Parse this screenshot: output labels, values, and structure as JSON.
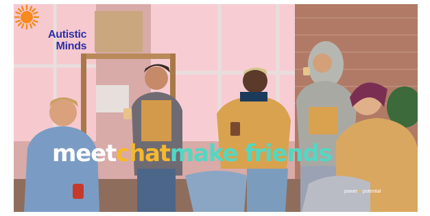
{
  "logo": {
    "line1": "Autistic",
    "line2": "Minds",
    "text_color": "#2d2fa8",
    "sun_color": "#f58a1f",
    "icon": "sun-icon"
  },
  "tagline": {
    "word1": "meet",
    "word2": "chat",
    "word3": "make friends",
    "colors": [
      "#ffffff",
      "#f5b82e",
      "#53d7c3"
    ]
  },
  "brand_mark": {
    "part1": "power",
    "separator": "of",
    "part2": "potential"
  }
}
